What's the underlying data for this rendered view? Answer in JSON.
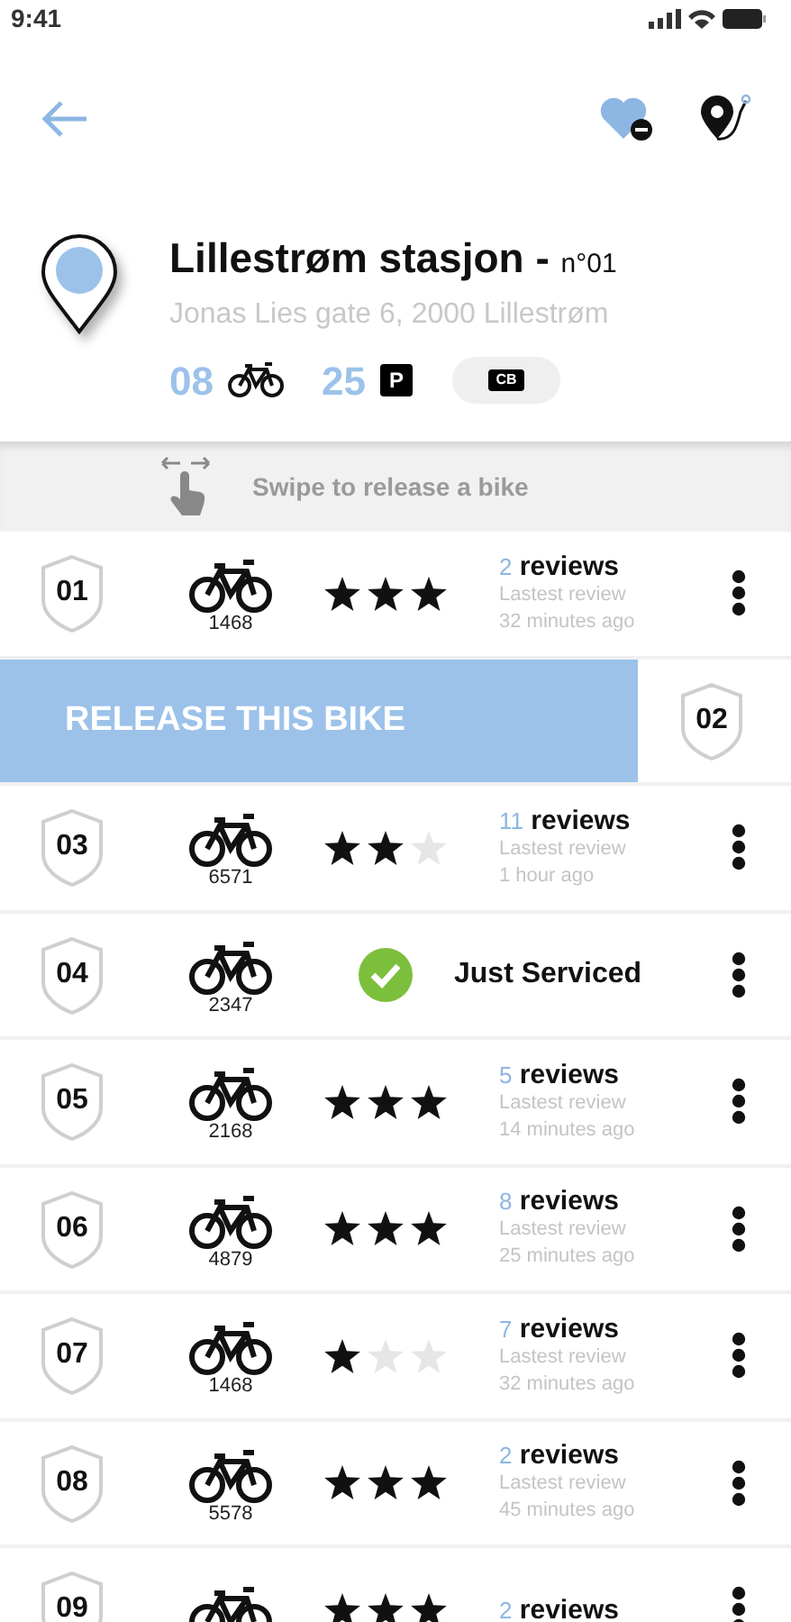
{
  "status_bar": {
    "time": "9:41"
  },
  "station": {
    "name": "Lillestrøm stasjon - ",
    "number": "n°01",
    "address": "Jonas Lies gate 6, 2000 Lillestrøm",
    "bikes": "08",
    "parking": "25",
    "parking_sign": "P",
    "card": "CB"
  },
  "swipe_hint": "Swipe to release a bike",
  "rows": [
    {
      "kind": "rated",
      "number": "01",
      "bike_id": "1468",
      "stars": 3,
      "review_count": "2",
      "review_label": "reviews",
      "latest": "Lastest review",
      "time": "32 minutes ago"
    },
    {
      "kind": "swiped",
      "number": "02",
      "action": "RELEASE THIS BIKE"
    },
    {
      "kind": "rated",
      "number": "03",
      "bike_id": "6571",
      "stars": 2,
      "review_count": "11",
      "review_label": "reviews",
      "latest": "Lastest review",
      "time": "1 hour ago"
    },
    {
      "kind": "serviced",
      "number": "04",
      "bike_id": "2347",
      "status": "Just Serviced"
    },
    {
      "kind": "rated",
      "number": "05",
      "bike_id": "2168",
      "stars": 3,
      "review_count": "5",
      "review_label": "reviews",
      "latest": "Lastest review",
      "time": "14 minutes ago"
    },
    {
      "kind": "rated",
      "number": "06",
      "bike_id": "4879",
      "stars": 3,
      "review_count": "8",
      "review_label": "reviews",
      "latest": "Lastest review",
      "time": "25 minutes ago"
    },
    {
      "kind": "rated",
      "number": "07",
      "bike_id": "1468",
      "stars": 1,
      "review_count": "7",
      "review_label": "reviews",
      "latest": "Lastest review",
      "time": "32 minutes ago"
    },
    {
      "kind": "rated",
      "number": "08",
      "bike_id": "5578",
      "stars": 3,
      "review_count": "2",
      "review_label": "reviews",
      "latest": "Lastest review",
      "time": "45 minutes ago"
    },
    {
      "kind": "rated",
      "number": "09",
      "stars": 3,
      "review_count": "2",
      "review_label": "reviews"
    }
  ]
}
